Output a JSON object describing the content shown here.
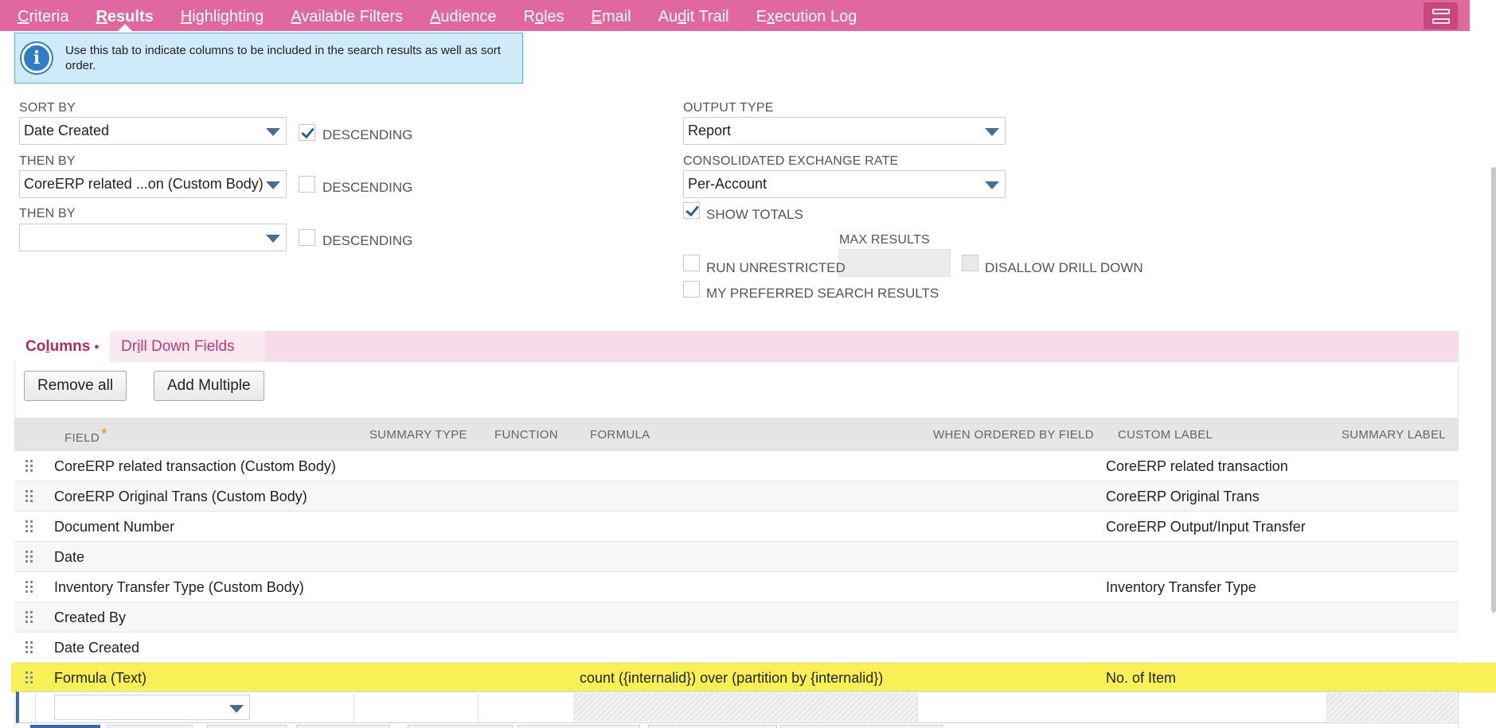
{
  "tabs": [
    {
      "pre": "",
      "key": "C",
      "post": "riteria",
      "active": false,
      "name": "tab-criteria"
    },
    {
      "pre": "",
      "key": "R",
      "post": "esults",
      "active": true,
      "name": "tab-results"
    },
    {
      "pre": "",
      "key": "H",
      "post": "ighlighting",
      "active": false,
      "name": "tab-highlighting"
    },
    {
      "pre": "",
      "key": "A",
      "post": "vailable Filters",
      "active": false,
      "name": "tab-available-filters"
    },
    {
      "pre": "",
      "key": "A",
      "post": "udience",
      "active": false,
      "name": "tab-audience"
    },
    {
      "pre": "R",
      "key": "o",
      "post": "les",
      "active": false,
      "name": "tab-roles"
    },
    {
      "pre": "",
      "key": "E",
      "post": "mail",
      "active": false,
      "name": "tab-email"
    },
    {
      "pre": "Au",
      "key": "d",
      "post": "it Trail",
      "active": false,
      "name": "tab-audit-trail"
    },
    {
      "pre": "E",
      "key": "x",
      "post": "ecution Log",
      "active": false,
      "name": "tab-execution-log"
    }
  ],
  "info": {
    "text": "Use this tab to indicate columns to be included in the search results as well as sort order."
  },
  "sort": {
    "sort_by_label": "SORT BY",
    "sort_by_value": "Date Created",
    "then_by_label": "THEN BY",
    "then_by_value": "CoreERP related ...on (Custom Body)",
    "then_by2_label": "THEN BY",
    "then_by2_value": "",
    "descending_label": "DESCENDING",
    "descending_1": true,
    "descending_2": false,
    "descending_3": false
  },
  "output": {
    "output_type_label": "OUTPUT TYPE",
    "output_type_value": "Report",
    "exchange_rate_label": "CONSOLIDATED EXCHANGE RATE",
    "exchange_rate_value": "Per-Account",
    "show_totals_label": "SHOW TOTALS",
    "show_totals": true,
    "max_results_label": "MAX RESULTS",
    "max_results_value": "",
    "run_unrestricted_label": "RUN UNRESTRICTED",
    "disallow_drill_down_label": "DISALLOW DRILL DOWN",
    "my_preferred_label": "MY PREFERRED SEARCH RESULTS"
  },
  "subtabs": {
    "columns_pre": "Co",
    "columns_key": "l",
    "columns_post": "umns",
    "columns_marker": "•",
    "drill_pre": "Dr",
    "drill_key": "i",
    "drill_post": "ll Down Fields"
  },
  "buttons": {
    "remove_all": "Remove all",
    "add_multiple": "Add Multiple"
  },
  "table": {
    "headers": {
      "field": "FIELD",
      "field_required": "*",
      "summary_type": "SUMMARY TYPE",
      "function": "FUNCTION",
      "formula": "FORMULA",
      "when_ordered": "WHEN ORDERED BY FIELD",
      "custom_label": "CUSTOM LABEL",
      "summary_label": "SUMMARY LABEL"
    },
    "rows": [
      {
        "field": "CoreERP related transaction (Custom Body)",
        "formula": "",
        "custom_label": "CoreERP related transaction"
      },
      {
        "field": "CoreERP Original Trans (Custom Body)",
        "formula": "",
        "custom_label": "CoreERP Original Trans"
      },
      {
        "field": "Document Number",
        "formula": "",
        "custom_label": "CoreERP Output/Input Transfer"
      },
      {
        "field": "Date",
        "formula": "",
        "custom_label": ""
      },
      {
        "field": "Inventory Transfer Type (Custom Body)",
        "formula": "",
        "custom_label": "Inventory Transfer Type"
      },
      {
        "field": "Created By",
        "formula": "",
        "custom_label": ""
      },
      {
        "field": "Date Created",
        "formula": "",
        "custom_label": ""
      },
      {
        "field": "Formula (Text)",
        "formula": "count ({internalid}) over (partition by {internalid})",
        "custom_label": "No. of Item"
      }
    ]
  },
  "colors": {
    "tab_bar": "#e0679f",
    "highlight_row": "#f8f155",
    "subtab_bar": "#f8dbe8",
    "info_bg": "#cfeaf9"
  }
}
